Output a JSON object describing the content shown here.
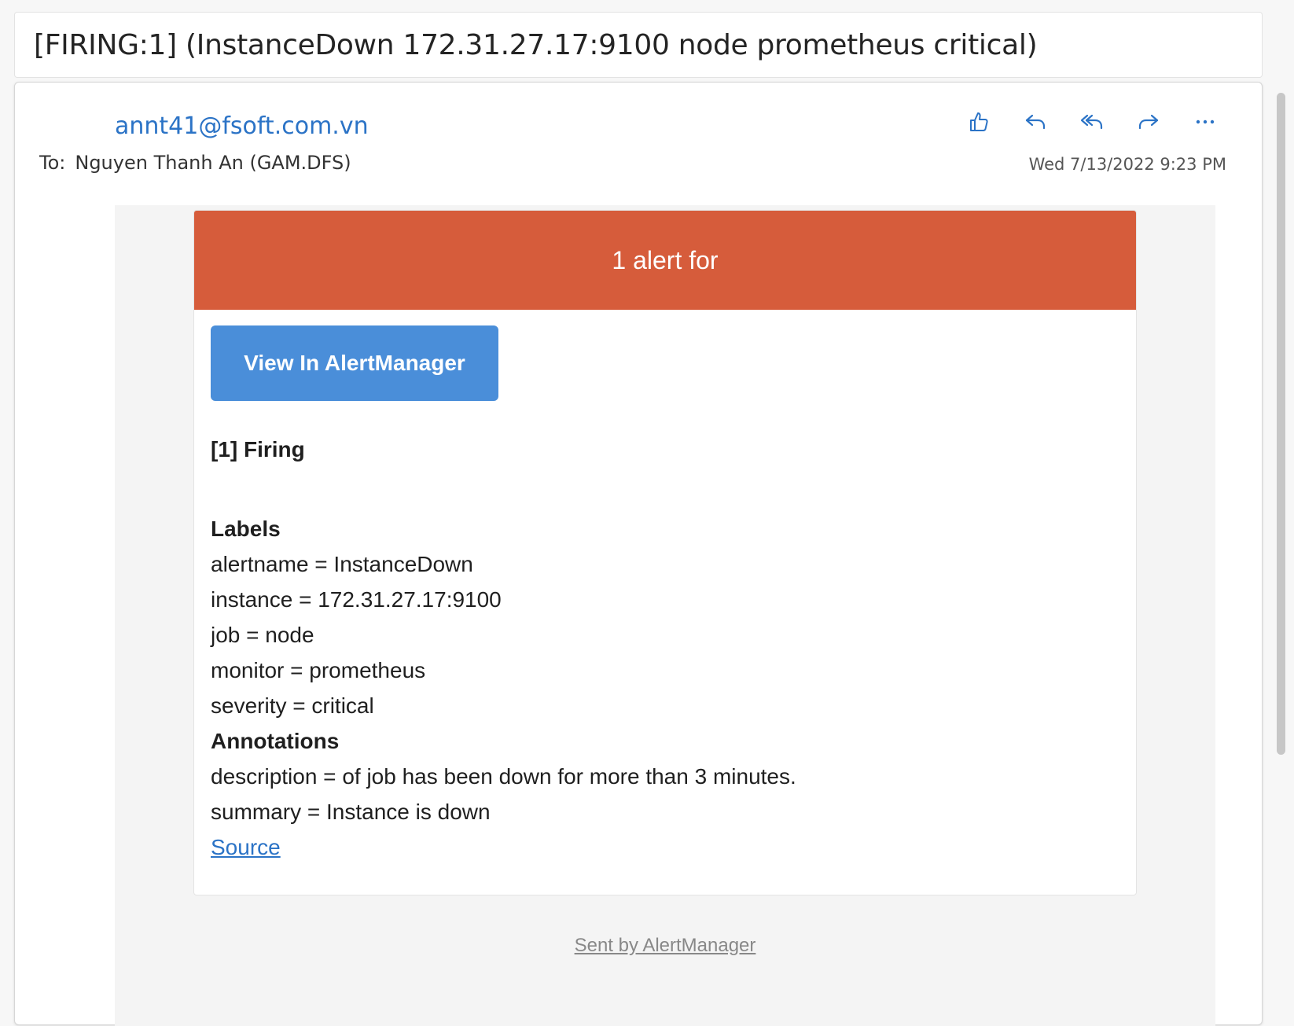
{
  "subject": "[FIRING:1] (InstanceDown 172.31.27.17:9100 node prometheus critical)",
  "message": {
    "from": "annt41@fsoft.com.vn",
    "to_label": "To:",
    "to_name": "Nguyen Thanh An (GAM.DFS)",
    "date": "Wed 7/13/2022 9:23 PM",
    "actions": [
      {
        "icon": "like-icon",
        "name": "like-button"
      },
      {
        "icon": "reply-icon",
        "name": "reply-button"
      },
      {
        "icon": "reply-all-icon",
        "name": "reply-all-button"
      },
      {
        "icon": "forward-icon",
        "name": "forward-button"
      },
      {
        "icon": "more-icon",
        "name": "more-actions-button"
      }
    ]
  },
  "alert": {
    "header": "1 alert for",
    "header_color": "#d65c3b",
    "button_label": "View In AlertManager",
    "button_color": "#4a8ed9",
    "firing_title": "[1] Firing",
    "labels_title": "Labels",
    "labels": [
      "alertname = InstanceDown",
      "instance = 172.31.27.17:9100",
      "job = node",
      "monitor = prometheus",
      "severity = critical"
    ],
    "annotations_title": "Annotations",
    "annotations": [
      "description = of job has been down for more than 3 minutes.",
      "summary = Instance is down"
    ],
    "source_link": "Source"
  },
  "footer": {
    "sent_by": "Sent by AlertManager"
  },
  "colors": {
    "link": "#2b73c6",
    "accent": "#2b73c6"
  }
}
